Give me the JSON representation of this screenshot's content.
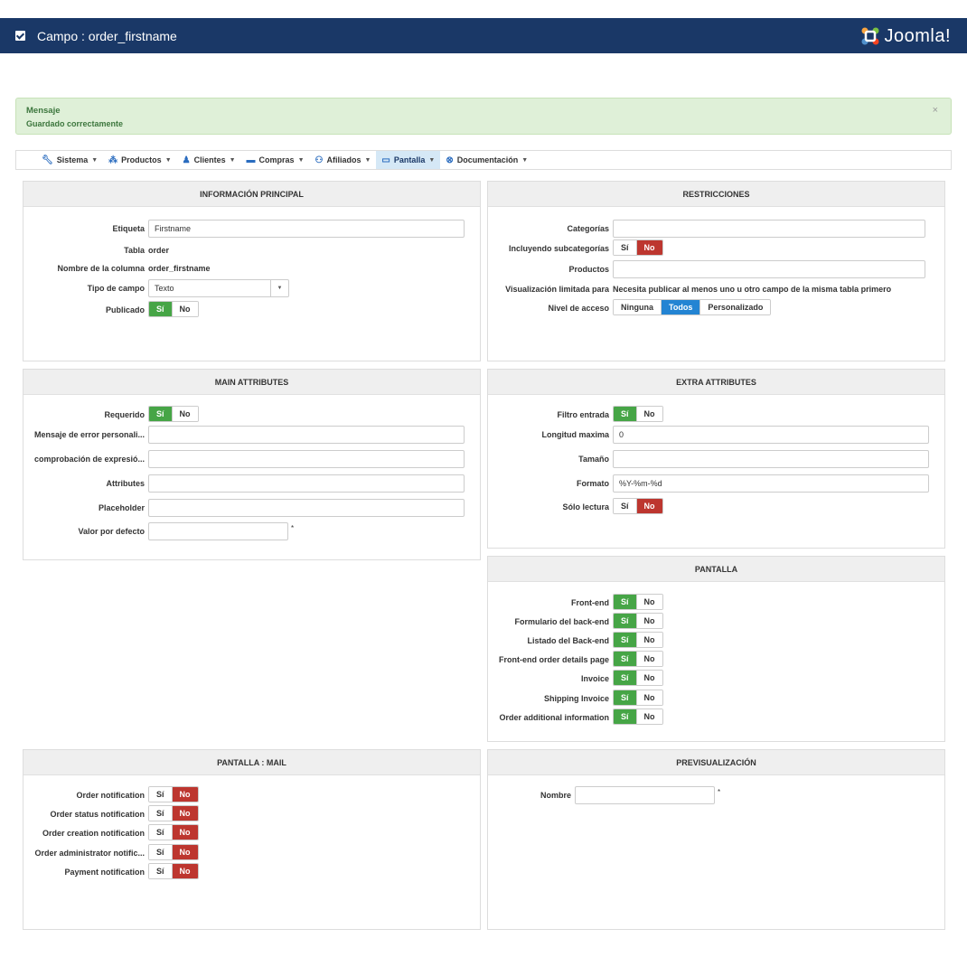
{
  "header": {
    "title": "Campo : order_firstname",
    "logo_text": "Joomla!"
  },
  "alert": {
    "heading": "Mensaje",
    "message": "Guardado correctamente",
    "close": "×"
  },
  "menu": [
    {
      "label": "Sistema",
      "icon": "wrench-icon"
    },
    {
      "label": "Productos",
      "icon": "cubes-icon"
    },
    {
      "label": "Clientes",
      "icon": "user-icon"
    },
    {
      "label": "Compras",
      "icon": "credit-card-icon"
    },
    {
      "label": "Afiliados",
      "icon": "users-icon"
    },
    {
      "label": "Pantalla",
      "icon": "monitor-icon",
      "active": true
    },
    {
      "label": "Documentación",
      "icon": "help-icon"
    }
  ],
  "main": {
    "title": "INFORMACIÓN PRINCIPAL",
    "etiqueta_label": "Etiqueta",
    "etiqueta_value": "Firstname",
    "tabla_label": "Tabla",
    "tabla_value": "order",
    "columna_label": "Nombre de la columna",
    "columna_value": "order_firstname",
    "tipo_label": "Tipo de campo",
    "tipo_value": "Texto",
    "publicado_label": "Publicado",
    "si": "Sí",
    "no": "No"
  },
  "restr": {
    "title": "RESTRICCIONES",
    "categorias_label": "Categorías",
    "subcat_label": "Incluyendo subcategorías",
    "productos_label": "Productos",
    "visual_label": "Visualización limitada para",
    "visual_value": "Necesita publicar al menos uno u otro campo de la misma tabla primero",
    "nivel_label": "Nivel de acceso",
    "nivel_options": [
      "Ninguna",
      "Todos",
      "Personalizado"
    ],
    "si": "Sí",
    "no": "No"
  },
  "mainattr": {
    "title": "MAIN ATTRIBUTES",
    "requerido_label": "Requerido",
    "error_label": "Mensaje de error personali...",
    "regex_label": "comprobación de expresió...",
    "attributes_label": "Attributes",
    "placeholder_label": "Placeholder",
    "default_label": "Valor por defecto",
    "si": "Sí",
    "no": "No",
    "star": "*"
  },
  "extra": {
    "title": "EXTRA ATTRIBUTES",
    "filtro_label": "Filtro entrada",
    "longitud_label": "Longitud maxima",
    "longitud_value": "0",
    "tamano_label": "Tamaño",
    "formato_label": "Formato",
    "formato_value": "%Y-%m-%d",
    "lectura_label": "Sólo lectura",
    "si": "Sí",
    "no": "No"
  },
  "pantalla": {
    "title": "PANTALLA",
    "rows": [
      "Front-end",
      "Formulario del back-end",
      "Listado del Back-end",
      "Front-end order details page",
      "Invoice",
      "Shipping Invoice",
      "Order additional information"
    ],
    "si": "Sí",
    "no": "No"
  },
  "mail": {
    "title": "PANTALLA : MAIL",
    "rows": [
      "Order notification",
      "Order status notification",
      "Order creation notification",
      "Order administrator notific...",
      "Payment notification"
    ],
    "si": "Sí",
    "no": "No"
  },
  "preview": {
    "title": "PREVISUALIZACIÓN",
    "nombre_label": "Nombre",
    "star": "*"
  },
  "colors": {
    "header": "#1a3867",
    "green": "#46a546",
    "red": "#bd362f",
    "blue": "#2384d3"
  }
}
